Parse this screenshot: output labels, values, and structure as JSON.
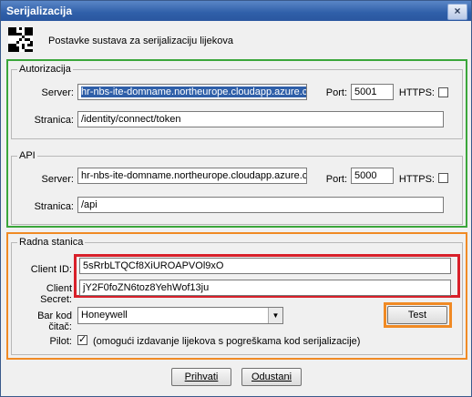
{
  "window": {
    "title": "Serijalizacija",
    "close_label": "×"
  },
  "header": {
    "subtitle": "Postavke sustava za serijalizaciju lijekova"
  },
  "autorizacija": {
    "legend": "Autorizacija",
    "server_label": "Server:",
    "server_value": "hr-nbs-ite-domname.northeurope.cloudapp.azure.com",
    "port_label": "Port:",
    "port_value": "5001",
    "https_label": "HTTPS:",
    "https_checked": false,
    "stranica_label": "Stranica:",
    "stranica_value": "/identity/connect/token"
  },
  "api": {
    "legend": "API",
    "server_label": "Server:",
    "server_value": "hr-nbs-ite-domname.northeurope.cloudapp.azure.com",
    "port_label": "Port:",
    "port_value": "5000",
    "https_label": "HTTPS:",
    "https_checked": false,
    "stranica_label": "Stranica:",
    "stranica_value": "/api"
  },
  "radna_stanica": {
    "legend": "Radna stanica",
    "client_id_label": "Client ID:",
    "client_id_value": "5sRrbLTQCf8XiUROAPVOl9xO",
    "client_secret_label": "Client Secret:",
    "client_secret_value": "jY2F0foZN6toz8YehWof13ju",
    "barkod_label": "Bar kod čitač:",
    "barkod_value": "Honeywell",
    "test_label": "Test",
    "pilot_label": "Pilot:",
    "pilot_checked": true,
    "pilot_text": "(omogući izdavanje lijekova s pogreškama kod serijalizacije)"
  },
  "buttons": {
    "prihvati": "Prihvati",
    "odustani": "Odustani"
  },
  "colors": {
    "green_highlight": "#3aa63a",
    "orange_highlight": "#f08a24",
    "red_highlight": "#d8202a"
  }
}
